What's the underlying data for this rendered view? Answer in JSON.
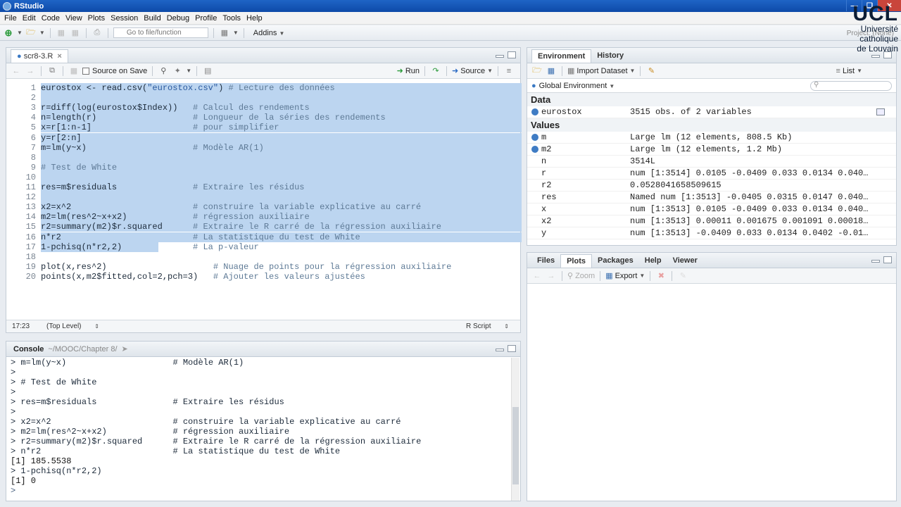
{
  "window": {
    "title": "RStudio"
  },
  "menu": [
    "File",
    "Edit",
    "Code",
    "View",
    "Plots",
    "Session",
    "Build",
    "Debug",
    "Profile",
    "Tools",
    "Help"
  ],
  "toolbar": {
    "goto_placeholder": "Go to file/function",
    "addins": "Addins",
    "project": "Project: (None)"
  },
  "logo": {
    "big": "UCL",
    "line1": "Université",
    "line2": "catholique",
    "line3": "de Louvain"
  },
  "editor": {
    "tab": "scr8-3.R",
    "source_on_save": "Source on Save",
    "run": "Run",
    "source": "Source",
    "lines": [
      {
        "n": "1",
        "code": "eurostox <- read.csv(",
        "str": "\"eurostox.csv\"",
        "rest": ")",
        "cmt": " # Lecture des données",
        "sel": true
      },
      {
        "n": "2",
        "code": "",
        "cmt": "",
        "sel": true
      },
      {
        "n": "3",
        "code": "r=diff(log(eurostox$Index))   ",
        "cmt": "# Calcul des rendements",
        "sel": true
      },
      {
        "n": "4",
        "code": "n=length(r)                   ",
        "cmt": "# Longueur de la séries des rendements",
        "sel": true
      },
      {
        "n": "5",
        "code": "x=r[1:n-1]                    ",
        "cmt": "# pour simplifier",
        "sel": true
      },
      {
        "n": "6",
        "code": "y=r[2:n]",
        "cmt": "",
        "sel": true
      },
      {
        "n": "7",
        "code": "m=lm(y~x)                     ",
        "cmt": "# Modèle AR(1)",
        "sel": true
      },
      {
        "n": "8",
        "code": "",
        "cmt": "",
        "sel": true
      },
      {
        "n": "9",
        "code": "",
        "cmt": "# Test de White",
        "sel": true
      },
      {
        "n": "10",
        "code": "",
        "cmt": "",
        "sel": true
      },
      {
        "n": "11",
        "code": "res=m$residuals               ",
        "cmt": "# Extraire les résidus",
        "sel": true
      },
      {
        "n": "12",
        "code": "",
        "cmt": "",
        "sel": true
      },
      {
        "n": "13",
        "code": "x2=x^2                        ",
        "cmt": "# construire la variable explicative au carré",
        "sel": true
      },
      {
        "n": "14",
        "code": "m2=lm(res^2~x+x2)             ",
        "cmt": "# régression auxiliaire",
        "sel": true
      },
      {
        "n": "15",
        "code": "r2=summary(m2)$r.squared      ",
        "cmt": "# Extraire le R carré de la régression auxiliaire",
        "sel": true
      },
      {
        "n": "16",
        "code": "n*r2                          ",
        "cmt": "# La statistique du test de White",
        "sel": true
      },
      {
        "n": "17",
        "code": "1-pchisq(n*r2,2)              ",
        "cmt": "# La p-valeur",
        "sel": false,
        "partial": true
      },
      {
        "n": "18",
        "code": "",
        "cmt": "",
        "sel": false
      },
      {
        "n": "19",
        "code": "plot(x,res^2)                     ",
        "cmt": "# Nuage de points pour la régression auxiliaire",
        "sel": false
      },
      {
        "n": "20",
        "code": "points(x,m2$fitted,col=2,pch=3)   ",
        "cmt": "# Ajouter les valeurs ajustées",
        "sel": false
      }
    ],
    "status_pos": "17:23",
    "status_level": "(Top Level)",
    "status_type": "R Script"
  },
  "console": {
    "tab": "Console",
    "path": "~/MOOC/Chapter 8/",
    "lines": [
      {
        "t": "> m=lm(y~x)                     # Modèle AR(1)",
        "k": "in"
      },
      {
        "t": ">",
        "k": "in"
      },
      {
        "t": "> # Test de White",
        "k": "in"
      },
      {
        "t": ">",
        "k": "in"
      },
      {
        "t": "> res=m$residuals               # Extraire les résidus",
        "k": "in"
      },
      {
        "t": ">",
        "k": "in"
      },
      {
        "t": "> x2=x^2                        # construire la variable explicative au carré",
        "k": "in"
      },
      {
        "t": "> m2=lm(res^2~x+x2)             # régression auxiliaire",
        "k": "in"
      },
      {
        "t": "> r2=summary(m2)$r.squared      # Extraire le R carré de la régression auxiliaire",
        "k": "in"
      },
      {
        "t": "> n*r2                          # La statistique du test de White",
        "k": "in"
      },
      {
        "t": "[1] 185.5538",
        "k": "out"
      },
      {
        "t": "> 1-pchisq(n*r2,2)",
        "k": "in"
      },
      {
        "t": "[1] 0",
        "k": "out"
      },
      {
        "t": ">",
        "k": "prompt"
      }
    ]
  },
  "env": {
    "tabs": [
      "Environment",
      "History"
    ],
    "import": "Import Dataset",
    "list": "List",
    "scope": "Global Environment",
    "data_header": "Data",
    "values_header": "Values",
    "data": [
      {
        "name": "eurostox",
        "val": "3515 obs. of 2 variables"
      }
    ],
    "values": [
      {
        "name": "m",
        "val": "Large lm (12 elements, 808.5 Kb)",
        "dot": true
      },
      {
        "name": "m2",
        "val": "Large lm (12 elements, 1.2 Mb)",
        "dot": true
      },
      {
        "name": "n",
        "val": "3514L",
        "dot": false
      },
      {
        "name": "r",
        "val": "num [1:3514] 0.0105 -0.0409 0.033 0.0134 0.040…",
        "dot": false
      },
      {
        "name": "r2",
        "val": "0.0528041658509615",
        "dot": false
      },
      {
        "name": "res",
        "val": "Named num [1:3513] -0.0405 0.0315 0.0147 0.040…",
        "dot": false
      },
      {
        "name": "x",
        "val": "num [1:3513] 0.0105 -0.0409 0.033 0.0134 0.040…",
        "dot": false
      },
      {
        "name": "x2",
        "val": "num [1:3513] 0.00011 0.001675 0.001091 0.00018…",
        "dot": false
      },
      {
        "name": "y",
        "val": "num [1:3513] -0.0409 0.033 0.0134 0.0402 -0.01…",
        "dot": false
      }
    ]
  },
  "files": {
    "tabs": [
      "Files",
      "Plots",
      "Packages",
      "Help",
      "Viewer"
    ],
    "zoom": "Zoom",
    "export": "Export"
  }
}
